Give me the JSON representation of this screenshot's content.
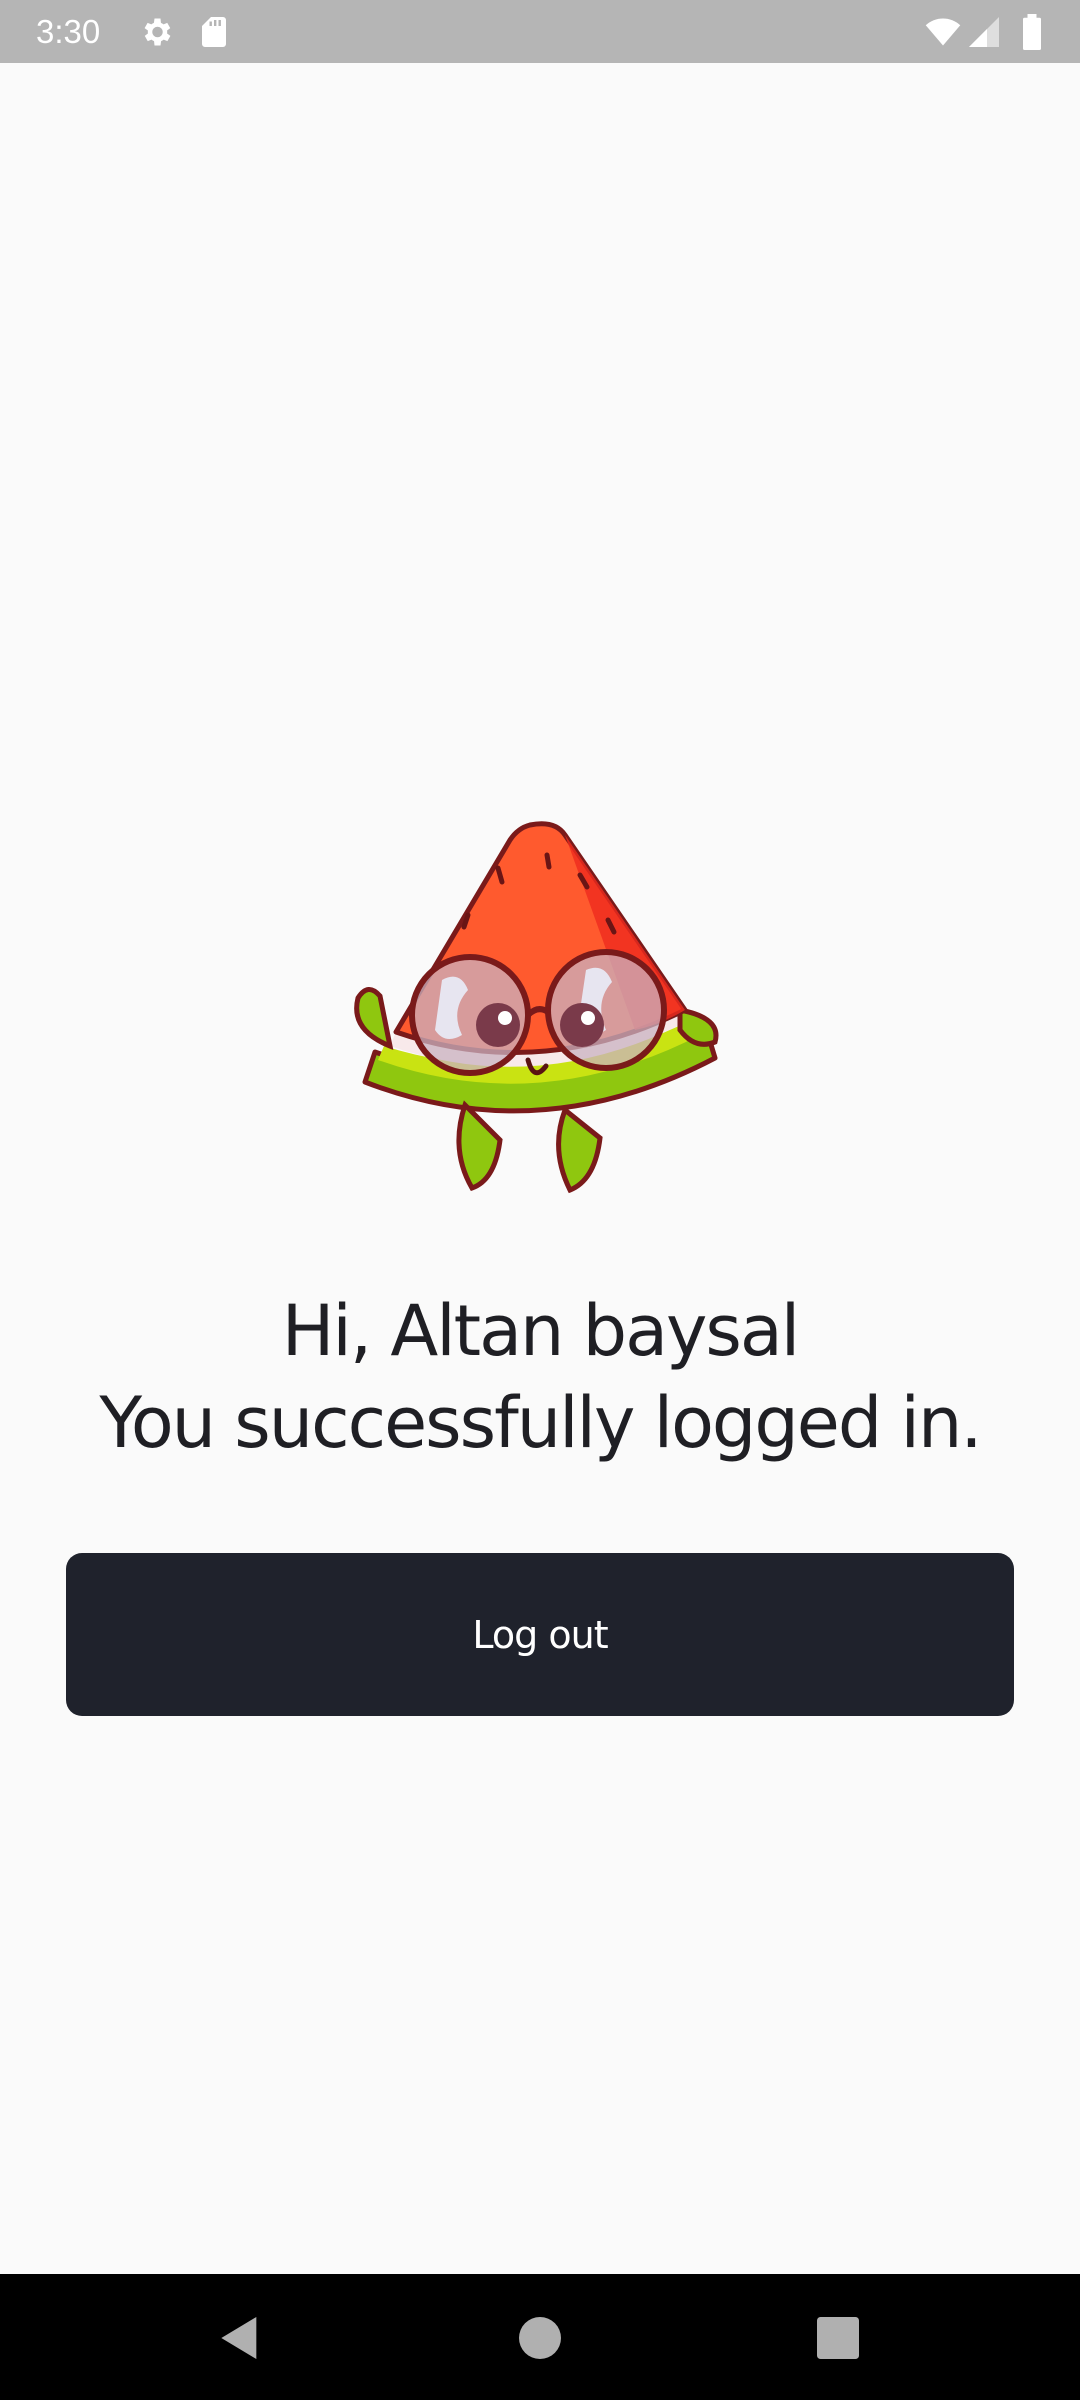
{
  "status_bar": {
    "time": "3:30",
    "icons": [
      "settings-icon",
      "sd-card-icon",
      "wifi-icon",
      "signal-icon",
      "battery-icon"
    ],
    "background": "#b5b5b5"
  },
  "main": {
    "mascot_icon": "watermelon-mascot-icon",
    "greeting_line1": "Hi, Altan baysal",
    "greeting_line2": "You successfully logged in.",
    "logout_label": "Log out",
    "button_color": "#1f222c",
    "text_color": "#1f1f24"
  },
  "nav_bar": {
    "icons": [
      "back-icon",
      "home-icon",
      "recents-icon"
    ],
    "background": "#000000"
  }
}
